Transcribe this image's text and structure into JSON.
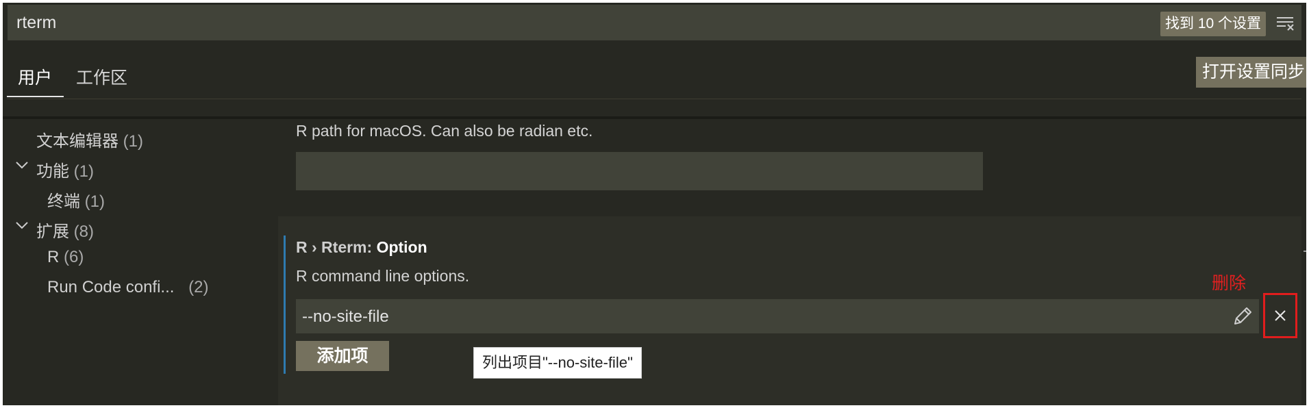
{
  "search": {
    "value": "rterm",
    "result_count": "找到 10 个设置",
    "filter_icon": "clear-filter-icon"
  },
  "tabs": [
    {
      "label": "用户",
      "active": true
    },
    {
      "label": "工作区",
      "active": false
    }
  ],
  "sync_button": "打开设置同步",
  "toc": [
    {
      "label": "文本编辑器",
      "count": "(1)",
      "expandable": false
    },
    {
      "label": "功能",
      "count": "(1)",
      "expandable": true,
      "icon": "chevron-down-icon"
    },
    {
      "label": "终端",
      "count": "(1)",
      "expandable": false
    },
    {
      "label": "扩展",
      "count": "(8)",
      "expandable": true,
      "icon": "chevron-down-icon"
    },
    {
      "label": "R",
      "count": "(6)",
      "expandable": false
    },
    {
      "label": "Run Code confi...",
      "count": "(2)",
      "expandable": false
    }
  ],
  "mac_setting": {
    "description": "R path for macOS. Can also be radian etc.",
    "value": ""
  },
  "option_setting": {
    "category": "R › Rterm: ",
    "name": "Option",
    "description": "R command line options.",
    "items": [
      "--no-site-file"
    ],
    "add_label": "添加项",
    "edit_icon": "pencil-icon",
    "remove_icon": "close-icon"
  },
  "annotation": {
    "label": "删除",
    "color": "#e11d1d"
  },
  "tooltip": "列出项目\"--no-site-file\"",
  "colors": {
    "background": "#272822",
    "input_background": "#414339",
    "button_background": "#75715e",
    "focus_accent": "#2e7bb0"
  }
}
